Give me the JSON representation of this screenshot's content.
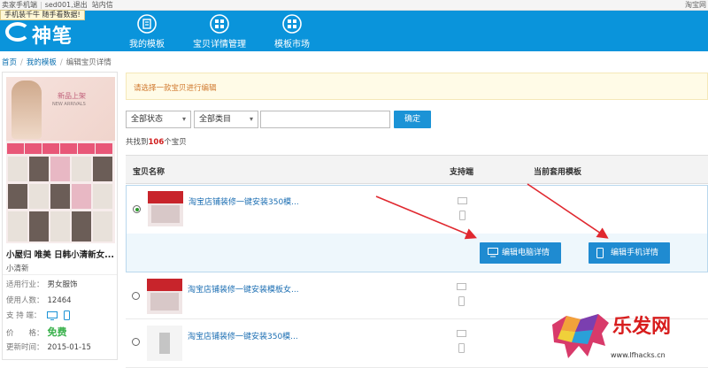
{
  "topbar": {
    "left_app": "卖家手机端",
    "user": "sed001",
    "logout": "退出",
    "message": "站内信",
    "right_text": "淘宝网"
  },
  "tooltip": "手机装千牛 随手看数据!",
  "nav": {
    "logo_text": "神笔",
    "items": [
      {
        "label": "我的模板",
        "icon": "template-icon"
      },
      {
        "label": "宝贝详情管理",
        "icon": "grid-icon"
      },
      {
        "label": "模板市场",
        "icon": "market-icon"
      }
    ]
  },
  "breadcrumb": [
    "首页",
    "我的模板",
    "编辑宝贝详情"
  ],
  "card": {
    "banner_title": "新品上架",
    "banner_sub": "NEW ARRIVALS",
    "shop_name": "小屋归 唯美 日韩小清新女...",
    "shop_desc": "小清新",
    "industry_label": "适用行业：",
    "industry": "男女服饰",
    "users_label": "使用人数：",
    "users": "12464",
    "support_label": "支 持 端：",
    "price_label": "价　　格：",
    "price": "免费",
    "updated_label": "更新时间：",
    "updated": "2015-01-15"
  },
  "notice": "请选择一款宝贝进行编辑",
  "filters": {
    "status": "全部状态",
    "category": "全部类目",
    "search_placeholder": "",
    "confirm": "确定"
  },
  "count": {
    "prefix": "共找到",
    "num": "106",
    "suffix": "个宝贝"
  },
  "table": {
    "headers": [
      "宝贝名称",
      "支持端",
      "当前套用模板"
    ],
    "rows": [
      {
        "title": "淘宝店铺装修一键安装350模...",
        "selected": true
      },
      {
        "title": "淘宝店铺装修一键安装模板女...",
        "selected": false
      },
      {
        "title": "淘宝店铺装修一键安装350模...",
        "selected": false
      }
    ]
  },
  "actions": {
    "edit_pc": "编辑电脑详情",
    "edit_mobile": "编辑手机详情"
  },
  "watermark": {
    "brand": "乐发网",
    "url": "www.lfhacks.cn"
  },
  "colors": {
    "nav_blue": "#0a94db",
    "button_blue": "#1f8bd1",
    "arrow_red": "#e0282f",
    "price_green": "#37b04a"
  }
}
